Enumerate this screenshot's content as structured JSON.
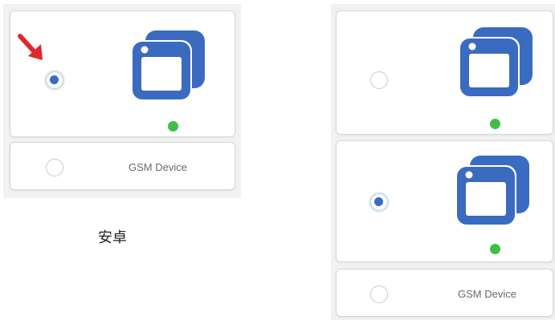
{
  "left_panel": {
    "device_card": {
      "icon": "app-window-icon",
      "selected": true,
      "status_color": "#3fbf48"
    },
    "gsm_card": {
      "label": "GSM Device",
      "selected": false
    },
    "caption": "安卓",
    "pointer": "red-arrow-icon"
  },
  "right_panel": {
    "device_card_1": {
      "icon": "app-window-icon",
      "selected": false,
      "status_color": "#3fbf48"
    },
    "device_card_2": {
      "icon": "app-window-icon",
      "selected": true,
      "status_color": "#3fbf48"
    },
    "gsm_card": {
      "label": "GSM Device",
      "selected": false
    }
  },
  "colors": {
    "icon_blue": "#3a6bc1",
    "radio_selected": "#3a6bc1",
    "arrow_red": "#e0282b",
    "status_green": "#3fbf48"
  }
}
